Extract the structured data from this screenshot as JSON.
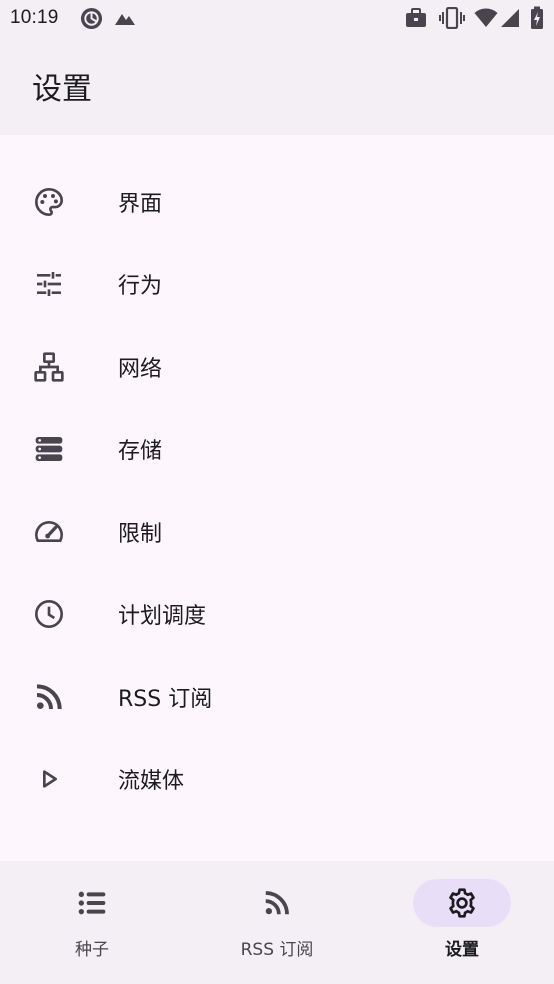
{
  "status_bar": {
    "time": "10:19",
    "left_icons": [
      "data-saver-icon",
      "signal-triangle-icon"
    ],
    "right_icons": [
      "briefcase-icon",
      "vibrate-icon",
      "wifi-icon",
      "cell-signal-icon",
      "battery-charging-icon"
    ]
  },
  "app_bar": {
    "title": "设置"
  },
  "settings": {
    "items": [
      {
        "icon": "palette-icon",
        "label": "界面"
      },
      {
        "icon": "tune-icon",
        "label": "行为"
      },
      {
        "icon": "network-icon",
        "label": "网络"
      },
      {
        "icon": "storage-icon",
        "label": "存储"
      },
      {
        "icon": "speed-icon",
        "label": "限制"
      },
      {
        "icon": "clock-icon",
        "label": "计划调度"
      },
      {
        "icon": "rss-icon",
        "label": "RSS 订阅"
      },
      {
        "icon": "play-icon",
        "label": "流媒体"
      }
    ]
  },
  "bottom_nav": {
    "items": [
      {
        "icon": "list-icon",
        "label": "种子",
        "active": false
      },
      {
        "icon": "rss-icon",
        "label": "RSS 订阅",
        "active": false
      },
      {
        "icon": "gear-icon",
        "label": "设置",
        "active": true
      }
    ]
  },
  "colors": {
    "background": "#fdf7fd",
    "bar_background": "#f3eff4",
    "active_indicator": "#e8def8",
    "icon": "#49454f",
    "text": "#1c1b1f"
  }
}
